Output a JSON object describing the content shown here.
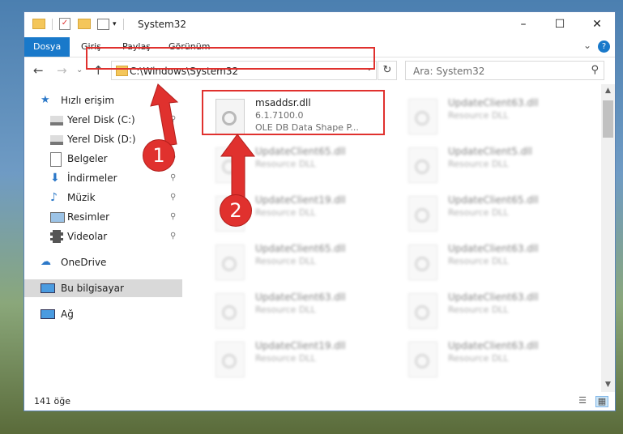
{
  "window": {
    "title": "System32",
    "controls": {
      "minimize": "–",
      "maximize": "☐",
      "close": "✕"
    },
    "help_icon": "?",
    "collapse_icon": "⌄"
  },
  "ribbon": {
    "tabs": [
      "Dosya",
      "Giriş",
      "Paylaş",
      "Görünüm"
    ]
  },
  "nav": {
    "back_icon": "←",
    "forward_icon": "→",
    "recent_icon": "⌄",
    "up_icon": "↑",
    "address": "C:\\Windows\\System32",
    "refresh_icon": "↻",
    "dropdown_icon": "⌄",
    "search_placeholder": "Ara: System32",
    "search_icon": "⚲"
  },
  "sidebar": {
    "items": [
      {
        "label": "Hızlı erişim",
        "icon": "star-icon",
        "pinned": false
      },
      {
        "label": "Yerel Disk (C:)",
        "icon": "drive-icon",
        "pinned": true
      },
      {
        "label": "Yerel Disk (D:)",
        "icon": "drive-icon",
        "pinned": true
      },
      {
        "label": "Belgeler",
        "icon": "documents-icon",
        "pinned": true
      },
      {
        "label": "İndirmeler",
        "icon": "download-icon",
        "pinned": true
      },
      {
        "label": "Müzik",
        "icon": "music-icon",
        "pinned": true
      },
      {
        "label": "Resimler",
        "icon": "pictures-icon",
        "pinned": true
      },
      {
        "label": "Videolar",
        "icon": "videos-icon",
        "pinned": true
      },
      {
        "label": "OneDrive",
        "icon": "cloud-icon",
        "pinned": false
      },
      {
        "label": "Bu bilgisayar",
        "icon": "computer-icon",
        "pinned": false
      },
      {
        "label": "Ağ",
        "icon": "network-icon",
        "pinned": false
      }
    ],
    "pin_glyph": "📌"
  },
  "files": {
    "highlighted": {
      "name": "msaddsr.dll",
      "version": "6.1.7100.0",
      "description": "OLE DB Data Shape P..."
    },
    "col2": [
      {
        "name": "UpdateClient63.dll",
        "type": "Resource DLL"
      },
      {
        "name": "UpdateClient5.dll",
        "type": "Resource DLL"
      },
      {
        "name": "UpdateClient65.dll",
        "type": "Resource DLL"
      },
      {
        "name": "UpdateClient63.dll",
        "type": "Resource DLL"
      },
      {
        "name": "UpdateClient63.dll",
        "type": "Resource DLL"
      },
      {
        "name": "UpdateClient63.dll",
        "type": "Resource DLL"
      }
    ],
    "col1": [
      {
        "name": "UpdateClient65.dll",
        "type": "Resource DLL"
      },
      {
        "name": "UpdateClient19.dll",
        "type": "Resource DLL"
      },
      {
        "name": "UpdateClient65.dll",
        "type": "Resource DLL"
      },
      {
        "name": "UpdateClient63.dll",
        "type": "Resource DLL"
      },
      {
        "name": "UpdateClient19.dll",
        "type": "Resource DLL"
      }
    ]
  },
  "status": {
    "count_text": "141 öğe"
  },
  "annotations": {
    "badge1": "1",
    "badge2": "2",
    "color": "#e0312e"
  }
}
